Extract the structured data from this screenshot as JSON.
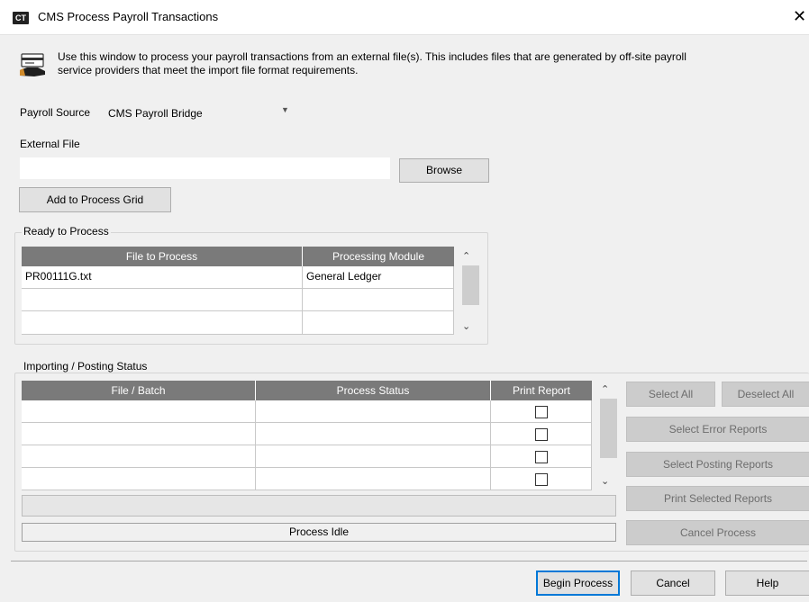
{
  "window": {
    "badge": "CT",
    "title": "CMS Process Payroll Transactions",
    "close_glyph": "✕"
  },
  "info": {
    "line1": "Use this window to process your payroll transactions from an external file(s). This includes files that are generated by off-site payroll",
    "line2": "service providers that meet the import file format requirements.",
    "icon": "payroll-card-icon"
  },
  "payroll_source": {
    "label": "Payroll Source",
    "value": "CMS Payroll Bridge"
  },
  "external_file": {
    "label": "External File",
    "value": "",
    "browse_label": "Browse",
    "add_label": "Add to Process Grid"
  },
  "ready": {
    "group_label": "Ready to Process",
    "columns": [
      "File to Process",
      "Processing Module"
    ],
    "rows": [
      [
        "PR00111G.txt",
        "General Ledger"
      ],
      [
        "",
        ""
      ],
      [
        "",
        ""
      ]
    ]
  },
  "status": {
    "group_label": "Importing / Posting Status",
    "columns": [
      "File / Batch",
      "Process Status",
      "Print Report"
    ],
    "rows": [
      {
        "file": "",
        "status": "",
        "print": false
      },
      {
        "file": "",
        "status": "",
        "print": false
      },
      {
        "file": "",
        "status": "",
        "print": false
      },
      {
        "file": "",
        "status": "",
        "print": false
      }
    ],
    "status_text": "Process Idle"
  },
  "side_buttons": {
    "select_all": "Select All",
    "deselect_all": "Deselect All",
    "select_error": "Select Error Reports",
    "select_posting": "Select Posting Reports",
    "print_selected": "Print Selected Reports",
    "cancel_process": "Cancel Process"
  },
  "footer": {
    "begin": "Begin Process",
    "cancel": "Cancel",
    "help": "Help"
  },
  "colors": {
    "grid_header": "#7a7a7a",
    "window_bg": "#f0f0f0"
  }
}
